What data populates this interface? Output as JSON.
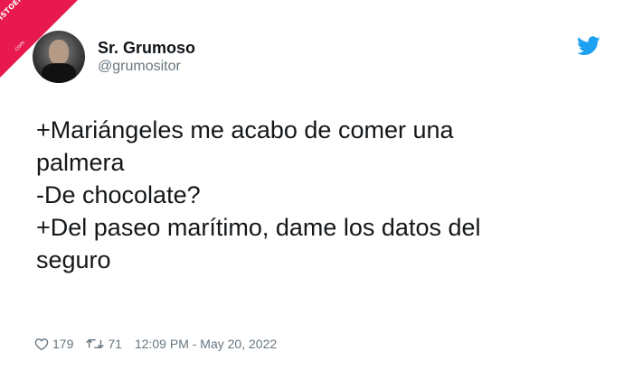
{
  "ribbon": {
    "text": "VISTOENLASREDES",
    "sub": ".com"
  },
  "tweet": {
    "display_name": "Sr. Grumoso",
    "handle": "@grumositor",
    "text": "+Mariángeles me acabo de comer una\npalmera\n-De chocolate?\n+Del paseo marítimo, dame los datos del\nseguro",
    "likes": "179",
    "retweets": "71",
    "timestamp": "12:09 PM - May 20, 2022"
  },
  "icons": {
    "brand": "twitter-bird-icon",
    "like": "heart-icon",
    "retweet": "retweet-icon"
  },
  "colors": {
    "ribbon": "#e8194f",
    "twitter_blue": "#1da1f2",
    "secondary_text": "#66757f"
  }
}
